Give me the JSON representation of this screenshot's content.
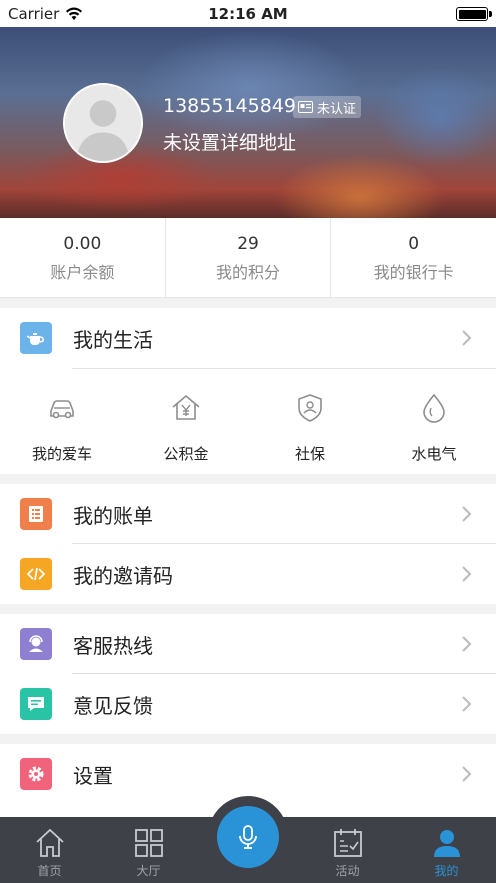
{
  "status_bar": {
    "carrier": "Carrier",
    "time": "12:16 AM"
  },
  "profile": {
    "phone": "13855145849",
    "badge": "未认证",
    "address": "未设置详细地址"
  },
  "stats": [
    {
      "value": "0.00",
      "label": "账户余额"
    },
    {
      "value": "29",
      "label": "我的积分"
    },
    {
      "value": "0",
      "label": "我的银行卡"
    }
  ],
  "life": {
    "title": "我的生活",
    "items": [
      {
        "label": "我的爱车",
        "icon": "car-icon"
      },
      {
        "label": "公积金",
        "icon": "housing-fund-icon"
      },
      {
        "label": "社保",
        "icon": "social-security-icon"
      },
      {
        "label": "水电气",
        "icon": "utility-drop-icon"
      }
    ]
  },
  "menu_group_1": [
    {
      "label": "我的账单",
      "icon": "bill-icon",
      "color": "#f0804b"
    },
    {
      "label": "我的邀请码",
      "icon": "code-icon",
      "color": "#f5a623"
    }
  ],
  "menu_group_2": [
    {
      "label": "客服热线",
      "icon": "customer-service-icon",
      "color": "#8f7fd1"
    },
    {
      "label": "意见反馈",
      "icon": "feedback-icon",
      "color": "#29c3a5"
    }
  ],
  "menu_group_3": [
    {
      "label": "设置",
      "icon": "settings-icon",
      "color": "#f0637a"
    }
  ],
  "tabbar": {
    "items": [
      {
        "label": "首页",
        "icon": "home-icon"
      },
      {
        "label": "大厅",
        "icon": "grid-icon"
      },
      {
        "label": "",
        "icon": "microphone-icon"
      },
      {
        "label": "活动",
        "icon": "calendar-icon"
      },
      {
        "label": "我的",
        "icon": "user-icon"
      }
    ],
    "active_color": "#2a93d8"
  }
}
